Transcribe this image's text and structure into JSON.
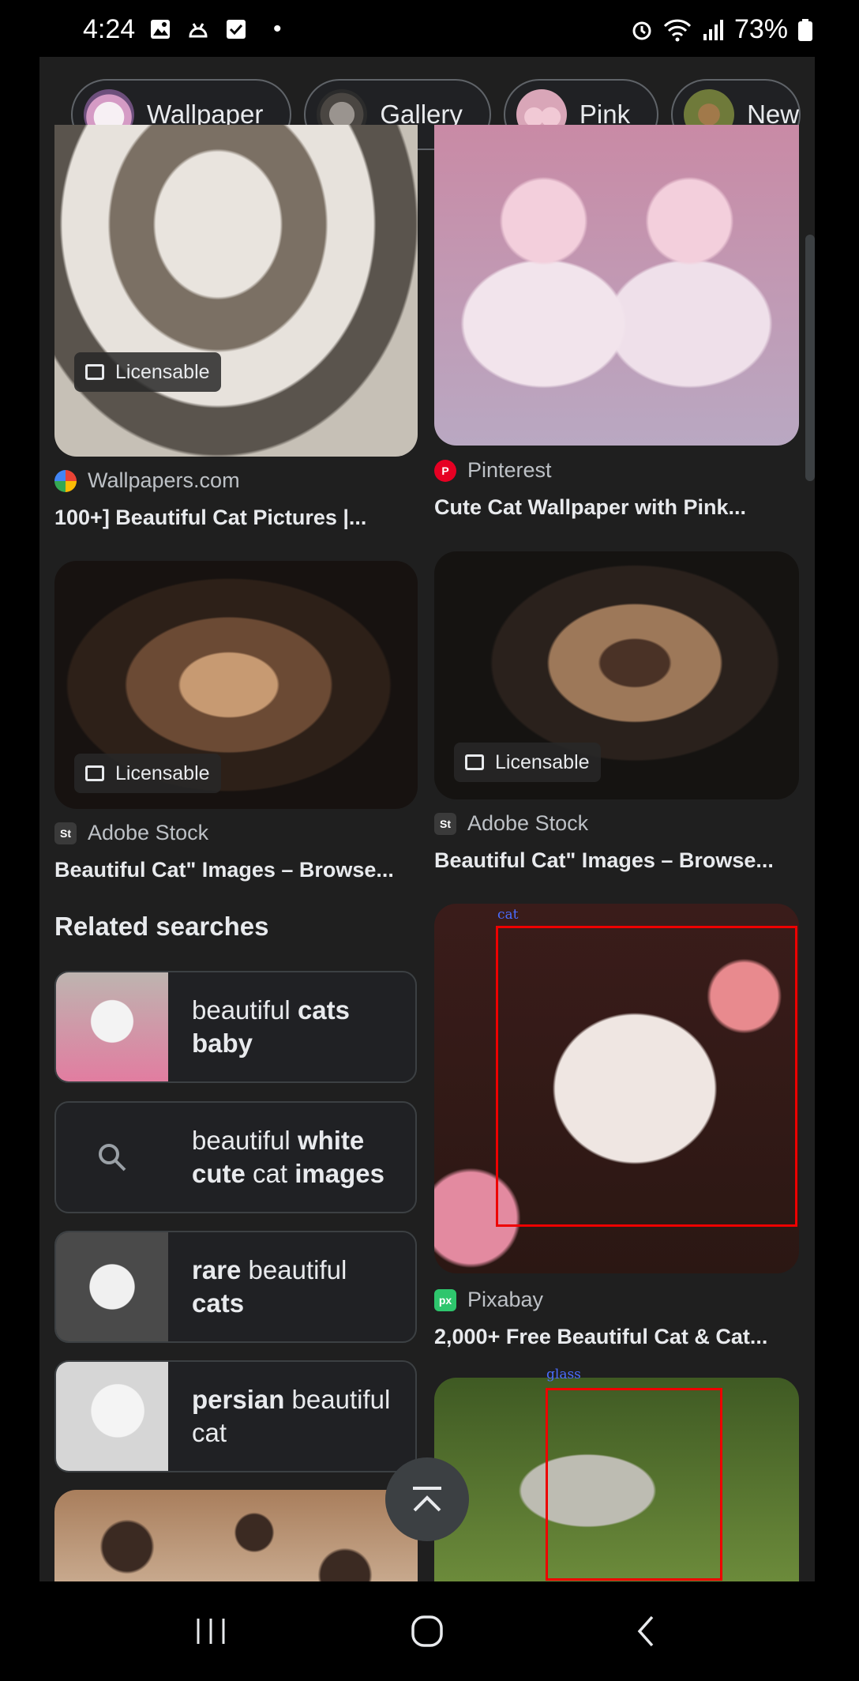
{
  "status_bar": {
    "time": "4:24",
    "dot": "•",
    "battery_percent": "73%",
    "icons_left": [
      "gallery-icon",
      "android-debug-icon",
      "check-box-icon"
    ],
    "icons_right": [
      "alarm-icon",
      "wifi-icon",
      "signal-icon",
      "battery-icon"
    ]
  },
  "chips": [
    {
      "label": "Wallpaper",
      "icon": "cat-thumbnail"
    },
    {
      "label": "Gallery",
      "icon": "cat-thumbnail"
    },
    {
      "label": "Pink",
      "icon": "cat-thumbnail"
    },
    {
      "label": "New",
      "icon": "cat-thumbnail"
    }
  ],
  "results": [
    {
      "source": "Wallpapers.com",
      "title": "100+] Beautiful Cat Pictures |...",
      "badge": "Licensable"
    },
    {
      "source": "Pinterest",
      "title": "Cute Cat Wallpaper with Pink...",
      "badge": ""
    },
    {
      "source": "Adobe Stock",
      "title": "Beautiful Cat\" Images – Browse...",
      "badge": "Licensable"
    },
    {
      "source": "Adobe Stock",
      "title": "Beautiful Cat\" Images – Browse...",
      "badge": "Licensable"
    },
    {
      "source": "Pixabay",
      "title": "2,000+ Free Beautiful Cat & Cat...",
      "badge": ""
    }
  ],
  "related": {
    "heading": "Related searches",
    "items": [
      {
        "parts": [
          {
            "t": "beautiful ",
            "b": false
          },
          {
            "t": "cats",
            "b": true
          },
          {
            "t": " baby",
            "b": true
          }
        ]
      },
      {
        "parts": [
          {
            "t": "beautiful ",
            "b": false
          },
          {
            "t": "white",
            "b": true
          },
          {
            "t": " cute",
            "b": true
          },
          {
            "t": " cat ",
            "b": false
          },
          {
            "t": "images",
            "b": true
          }
        ]
      },
      {
        "parts": [
          {
            "t": "rare",
            "b": true
          },
          {
            "t": " beautiful ",
            "b": false
          },
          {
            "t": "cats",
            "b": true
          }
        ]
      },
      {
        "parts": [
          {
            "t": "persian",
            "b": true
          },
          {
            "t": " beautiful ",
            "b": false
          },
          {
            "t": "cat",
            "b": false
          }
        ]
      }
    ]
  },
  "detections": [
    {
      "label": "cat"
    },
    {
      "label": "glass"
    }
  ],
  "colors": {
    "background": "#1f1f1f",
    "detection_box": "#ee0000",
    "detection_label": "#4a6cff"
  }
}
